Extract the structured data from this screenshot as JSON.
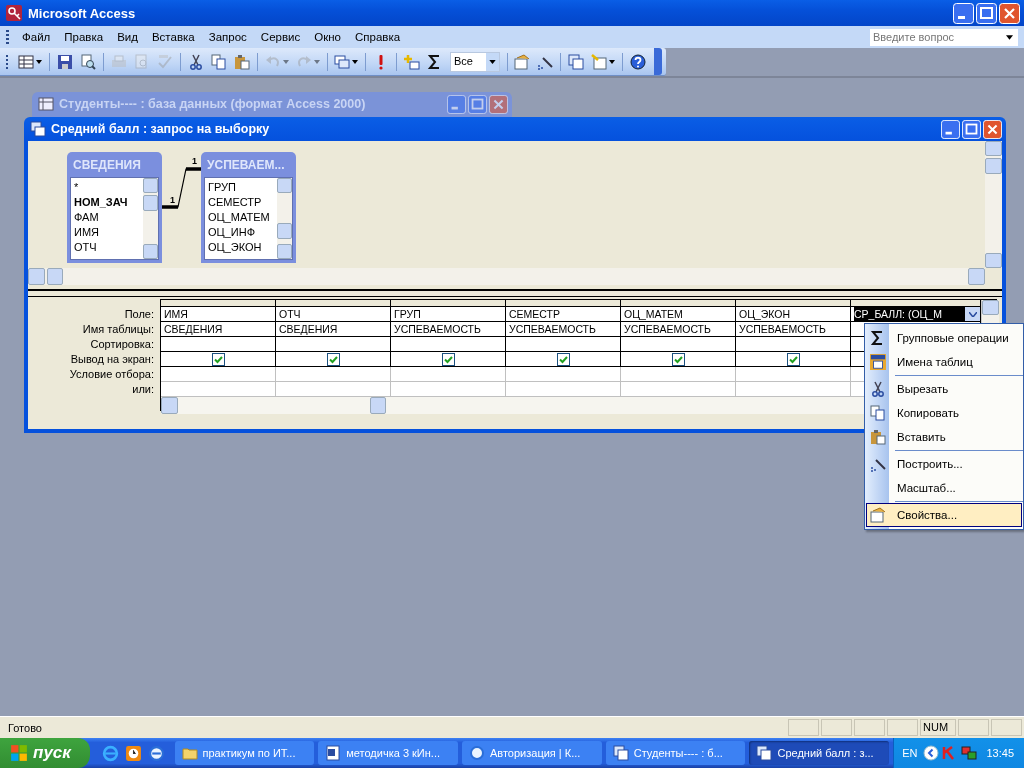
{
  "app": {
    "title": "Microsoft Access"
  },
  "menu": [
    "Файл",
    "Правка",
    "Вид",
    "Вставка",
    "Запрос",
    "Сервис",
    "Окно",
    "Справка"
  ],
  "help_box": {
    "placeholder": "Введите вопрос"
  },
  "toolbar": [
    {
      "kind": "view",
      "disabled": false,
      "dropdown": true
    },
    {
      "kind": "separator"
    },
    {
      "kind": "save",
      "disabled": false,
      "dropdown": false
    },
    {
      "kind": "file-search",
      "disabled": false,
      "dropdown": false
    },
    {
      "kind": "separator"
    },
    {
      "kind": "print",
      "disabled": true,
      "dropdown": false
    },
    {
      "kind": "preview",
      "disabled": true,
      "dropdown": false
    },
    {
      "kind": "spelling",
      "disabled": true,
      "dropdown": false
    },
    {
      "kind": "separator"
    },
    {
      "kind": "cut",
      "disabled": false,
      "dropdown": false
    },
    {
      "kind": "copy",
      "disabled": false,
      "dropdown": false
    },
    {
      "kind": "paste",
      "disabled": false,
      "dropdown": false
    },
    {
      "kind": "separator"
    },
    {
      "kind": "undo",
      "disabled": true,
      "dropdown": true
    },
    {
      "kind": "redo",
      "disabled": true,
      "dropdown": true
    },
    {
      "kind": "separator"
    },
    {
      "kind": "query-type",
      "disabled": false,
      "dropdown": true
    },
    {
      "kind": "separator"
    },
    {
      "kind": "run",
      "disabled": false,
      "dropdown": false
    },
    {
      "kind": "separator"
    },
    {
      "kind": "show-table",
      "disabled": false,
      "dropdown": false
    },
    {
      "kind": "totals",
      "disabled": false,
      "dropdown": false
    },
    {
      "kind": "combo",
      "value": "Все"
    },
    {
      "kind": "separator"
    },
    {
      "kind": "properties",
      "disabled": false,
      "dropdown": false
    },
    {
      "kind": "build",
      "disabled": false,
      "dropdown": false
    },
    {
      "kind": "separator"
    },
    {
      "kind": "database-window",
      "disabled": false,
      "dropdown": false
    },
    {
      "kind": "new-object",
      "disabled": false,
      "dropdown": true
    },
    {
      "kind": "separator"
    },
    {
      "kind": "help",
      "disabled": false,
      "dropdown": false
    }
  ],
  "background_window": {
    "title": "Студенты---- : база данных (формат Access 2000)",
    "active": false
  },
  "query_window": {
    "title": "Средний балл : запрос на выборку",
    "active": true
  },
  "tables": [
    {
      "name": "СВЕДЕНИЯ",
      "fields": [
        {
          "name": "*",
          "key": false
        },
        {
          "name": "НОМ_ЗАЧ",
          "key": true
        },
        {
          "name": "ФАМ",
          "key": false
        },
        {
          "name": "ИМЯ",
          "key": false
        },
        {
          "name": "ОТЧ",
          "key": false
        }
      ]
    },
    {
      "name": "УСПЕВАЕМ...",
      "fields": [
        {
          "name": "ГРУП",
          "key": false
        },
        {
          "name": "СЕМЕСТР",
          "key": false
        },
        {
          "name": "ОЦ_МАТЕМ",
          "key": false
        },
        {
          "name": "ОЦ_ИНФ",
          "key": false
        },
        {
          "name": "ОЦ_ЭКОН",
          "key": false
        }
      ]
    }
  ],
  "relationship": {
    "from_label": "1",
    "to_label": "1"
  },
  "grid": {
    "row_labels": [
      "Поле:",
      "Имя таблицы:",
      "Сортировка:",
      "Вывод на экран:",
      "Условие отбора:",
      "или:"
    ],
    "columns": [
      {
        "field": "ИМЯ",
        "table": "СВЕДЕНИЯ",
        "show": true,
        "selected": false
      },
      {
        "field": "ОТЧ",
        "table": "СВЕДЕНИЯ",
        "show": true,
        "selected": false
      },
      {
        "field": "ГРУП",
        "table": "УСПЕВАЕМОСТЬ",
        "show": true,
        "selected": false
      },
      {
        "field": "СЕМЕСТР",
        "table": "УСПЕВАЕМОСТЬ",
        "show": true,
        "selected": false
      },
      {
        "field": "ОЦ_МАТЕМ",
        "table": "УСПЕВАЕМОСТЬ",
        "show": true,
        "selected": false
      },
      {
        "field": "ОЦ_ЭКОН",
        "table": "УСПЕВАЕМОСТЬ",
        "show": true,
        "selected": false
      },
      {
        "field": "СР_БАЛЛ: (ОЦ_М",
        "selected": true
      }
    ]
  },
  "context_menu": {
    "items": [
      {
        "kind": "item",
        "label": "Групповые операции",
        "selected": false
      },
      {
        "kind": "item",
        "label": "Имена таблиц",
        "selected": false
      },
      {
        "kind": "separator"
      },
      {
        "kind": "item",
        "label": "Вырезать",
        "selected": false
      },
      {
        "kind": "item",
        "label": "Копировать",
        "selected": false
      },
      {
        "kind": "item",
        "label": "Вставить",
        "selected": false
      },
      {
        "kind": "separator"
      },
      {
        "kind": "item",
        "label": "Построить...",
        "selected": false
      },
      {
        "kind": "item",
        "label": "Масштаб...",
        "selected": false
      },
      {
        "kind": "separator"
      },
      {
        "kind": "item",
        "label": "Свойства...",
        "selected": true
      }
    ]
  },
  "status_bar": {
    "text": "Готово",
    "indicator": "NUM"
  },
  "taskbar": {
    "start": "пуск",
    "tasks": [
      {
        "label": "практикум по ИТ...",
        "selected": false
      },
      {
        "label": "методичка 3 кИн...",
        "selected": false
      },
      {
        "label": "Авторизация | К...",
        "selected": false
      },
      {
        "label": "Студенты---- : б...",
        "selected": false
      },
      {
        "label": "Средний балл : з...",
        "selected": true
      }
    ],
    "language": "EN",
    "time": "13:45"
  }
}
